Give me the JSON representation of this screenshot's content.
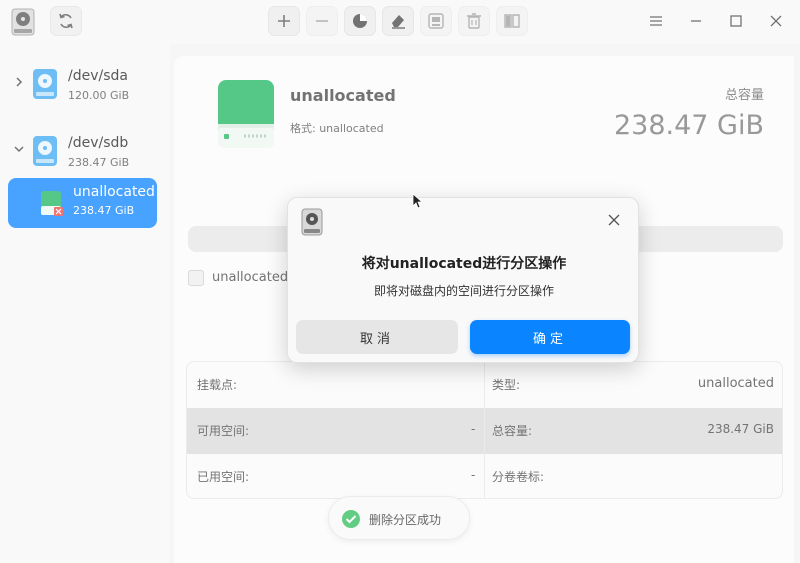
{
  "sidebar": {
    "devices": [
      {
        "name": "/dev/sda",
        "size": "120.00 GiB"
      },
      {
        "name": "/dev/sdb",
        "size": "238.47 GiB"
      }
    ],
    "partition": {
      "name": "unallocated",
      "size": "238.47 GiB"
    }
  },
  "main": {
    "name": "unallocated",
    "format": "格式: unallocated",
    "capacity_label": "总容量",
    "capacity_value": "238.47 GiB",
    "legend_label": "unallocated."
  },
  "info": {
    "mount_label": "挂载点:",
    "mount_value": "",
    "type_label": "类型:",
    "type_value": "unallocated",
    "free_label": "可用空间:",
    "free_value": "-",
    "total_label": "总容量:",
    "total_value": "238.47 GiB",
    "used_label": "已用空间:",
    "used_value": "-",
    "volume_label": "分卷卷标:",
    "volume_value": ""
  },
  "toast": {
    "message": "删除分区成功"
  },
  "dialog": {
    "title": "将对unallocated进行分区操作",
    "message": "即将对磁盘内的空间进行分区操作",
    "cancel_label": "取消",
    "ok_label": "确定"
  },
  "colors": {
    "accent": "#0a84ff",
    "disk_green": "#1db660",
    "disk_blue": "#3da8f0",
    "success": "#2ebd59"
  }
}
